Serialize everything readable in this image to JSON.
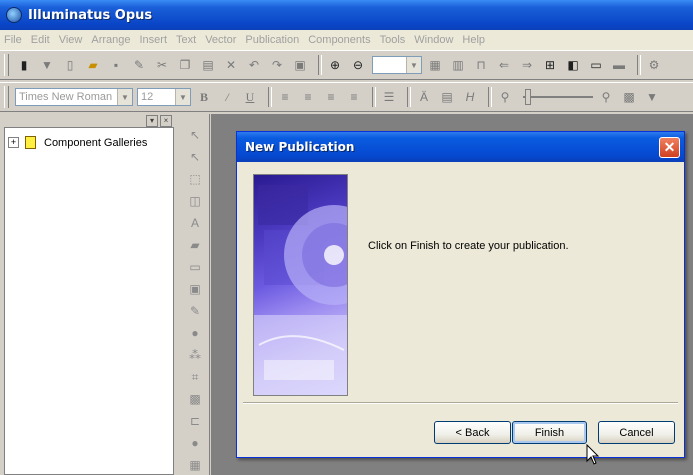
{
  "app": {
    "title": "Illuminatus Opus"
  },
  "menu": [
    "File",
    "Edit",
    "View",
    "Arrange",
    "Insert",
    "Text",
    "Vector",
    "Publication",
    "Components",
    "Tools",
    "Window",
    "Help"
  ],
  "format_toolbar": {
    "font": "Times New Roman",
    "size": "12"
  },
  "left_panel": {
    "tree_items": [
      "Component Galleries"
    ],
    "expander": "+"
  },
  "dialog": {
    "title": "New Publication",
    "message": "Click on Finish to create your publication.",
    "buttons": {
      "back": "< Back",
      "finish": "Finish",
      "cancel": "Cancel"
    },
    "close_glyph": "✕"
  },
  "colors": {
    "titlebar": "#0a46c8",
    "dialog_bg": "#ece9d8",
    "workspace": "#808080",
    "image_accent": "#6b5ae0"
  }
}
